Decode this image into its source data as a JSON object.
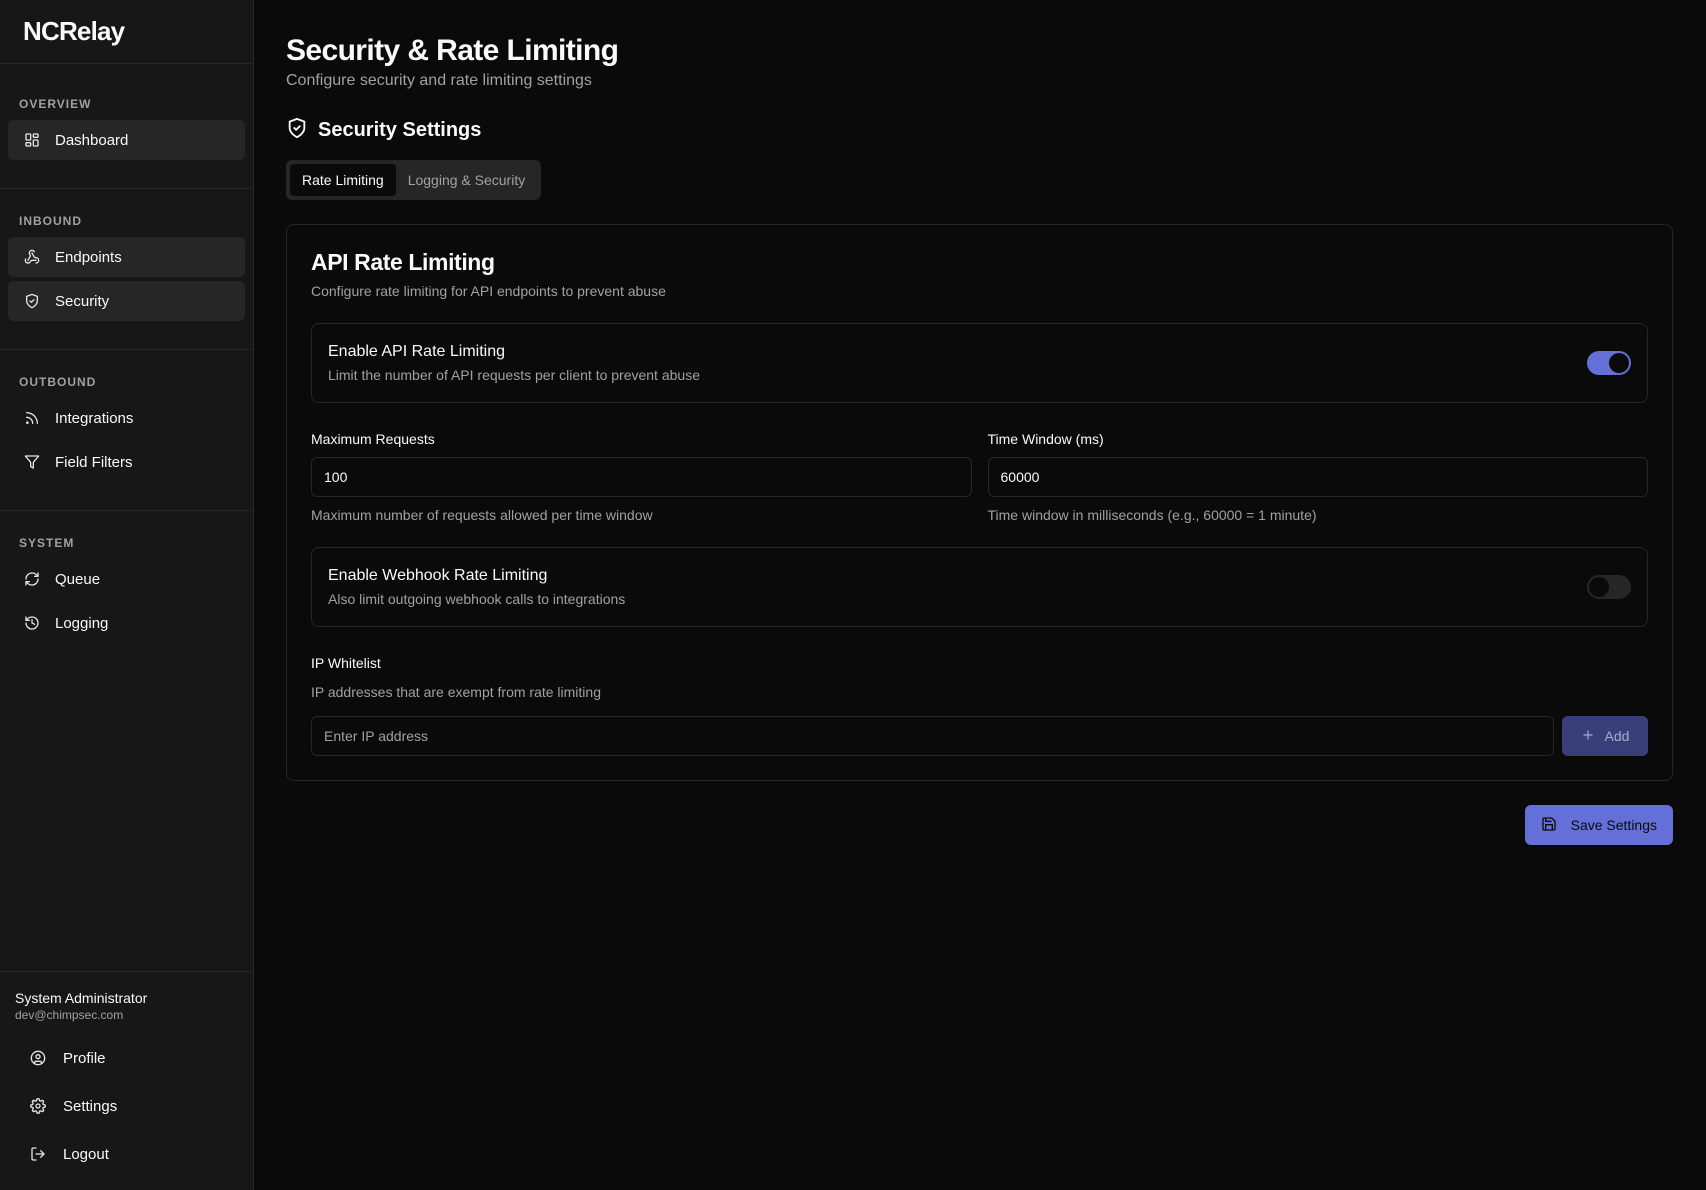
{
  "app": {
    "brand": "NCRelay"
  },
  "sidebar": {
    "groups": [
      {
        "label": "OVERVIEW",
        "items": [
          {
            "label": "Dashboard",
            "icon": "layout-dashboard-icon"
          }
        ]
      },
      {
        "label": "INBOUND",
        "items": [
          {
            "label": "Endpoints",
            "icon": "webhook-icon"
          },
          {
            "label": "Security",
            "icon": "shield-icon"
          }
        ]
      },
      {
        "label": "OUTBOUND",
        "items": [
          {
            "label": "Integrations",
            "icon": "rss-icon"
          },
          {
            "label": "Field Filters",
            "icon": "filter-icon"
          }
        ]
      },
      {
        "label": "SYSTEM",
        "items": [
          {
            "label": "Queue",
            "icon": "refresh-icon"
          },
          {
            "label": "Logging",
            "icon": "history-icon"
          }
        ]
      }
    ],
    "user": {
      "name": "System Administrator",
      "email": "dev@chimpsec.com",
      "links": [
        {
          "label": "Profile",
          "icon": "user-circle-icon"
        },
        {
          "label": "Settings",
          "icon": "gear-icon"
        },
        {
          "label": "Logout",
          "icon": "logout-icon"
        }
      ]
    }
  },
  "page": {
    "title": "Security & Rate Limiting",
    "subtitle": "Configure security and rate limiting settings",
    "section_title": "Security Settings",
    "tabs": [
      {
        "label": "Rate Limiting",
        "active": true
      },
      {
        "label": "Logging & Security",
        "active": false
      }
    ]
  },
  "card": {
    "title": "API Rate Limiting",
    "description": "Configure rate limiting for API endpoints to prevent abuse",
    "api_toggle": {
      "title": "Enable API Rate Limiting",
      "description": "Limit the number of API requests per client to prevent abuse",
      "enabled": true
    },
    "max_requests": {
      "label": "Maximum Requests",
      "value": "100",
      "help": "Maximum number of requests allowed per time window"
    },
    "time_window": {
      "label": "Time Window (ms)",
      "value": "60000",
      "help": "Time window in milliseconds (e.g., 60000 = 1 minute)"
    },
    "webhook_toggle": {
      "title": "Enable Webhook Rate Limiting",
      "description": "Also limit outgoing webhook calls to integrations",
      "enabled": false
    },
    "whitelist": {
      "label": "IP Whitelist",
      "description": "IP addresses that are exempt from rate limiting",
      "placeholder": "Enter IP address",
      "add_label": "Add"
    }
  },
  "actions": {
    "save_label": "Save Settings"
  },
  "colors": {
    "accent": "#6470d8",
    "background": "#0a0a0a",
    "sidebar": "#171717",
    "border": "#262626"
  }
}
